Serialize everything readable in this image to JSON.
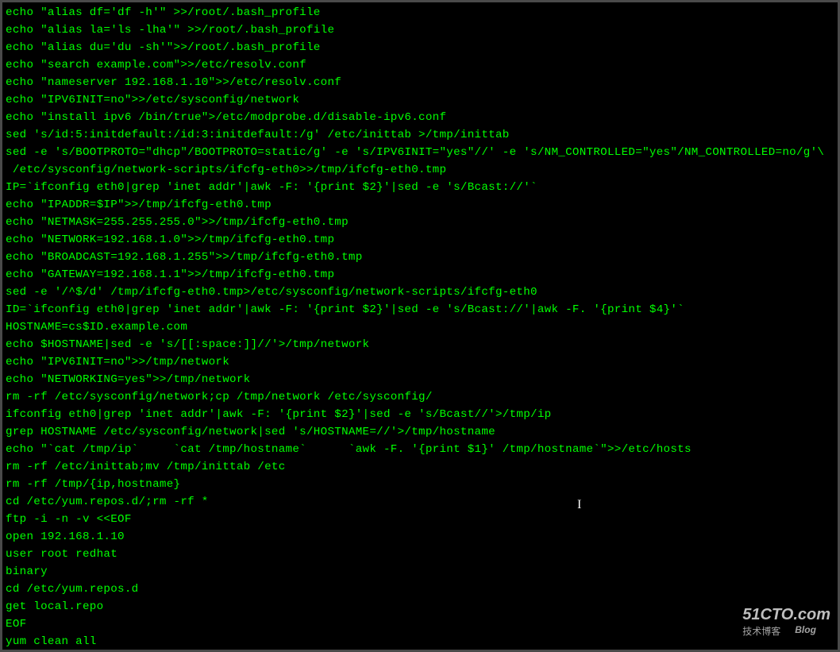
{
  "terminal": {
    "lines": [
      "echo \"alias df='df -h'\" >>/root/.bash_profile",
      "echo \"alias la='ls -lha'\" >>/root/.bash_profile",
      "echo \"alias du='du -sh'\">>/root/.bash_profile",
      "echo \"search example.com\">>/etc/resolv.conf",
      "echo \"nameserver 192.168.1.10\">>/etc/resolv.conf",
      "echo \"IPV6INIT=no\">>/etc/sysconfig/network",
      "echo \"install ipv6 /bin/true\">/etc/modprobe.d/disable-ipv6.conf",
      "sed 's/id:5:initdefault:/id:3:initdefault:/g' /etc/inittab >/tmp/inittab",
      "sed -e 's/BOOTPROTO=\"dhcp\"/BOOTPROTO=static/g' -e 's/IPV6INIT=\"yes\"//' -e 's/NM_CONTROLLED=\"yes\"/NM_CONTROLLED=no/g'\\",
      " /etc/sysconfig/network-scripts/ifcfg-eth0>>/tmp/ifcfg-eth0.tmp",
      "IP=`ifconfig eth0|grep 'inet addr'|awk -F: '{print $2}'|sed -e 's/Bcast://'`",
      "echo \"IPADDR=$IP\">>/tmp/ifcfg-eth0.tmp",
      "echo \"NETMASK=255.255.255.0\">>/tmp/ifcfg-eth0.tmp",
      "echo \"NETWORK=192.168.1.0\">>/tmp/ifcfg-eth0.tmp",
      "echo \"BROADCAST=192.168.1.255\">>/tmp/ifcfg-eth0.tmp",
      "echo \"GATEWAY=192.168.1.1\">>/tmp/ifcfg-eth0.tmp",
      "sed -e '/^$/d' /tmp/ifcfg-eth0.tmp>/etc/sysconfig/network-scripts/ifcfg-eth0",
      "ID=`ifconfig eth0|grep 'inet addr'|awk -F: '{print $2}'|sed -e 's/Bcast://'|awk -F. '{print $4}'`",
      "HOSTNAME=cs$ID.example.com",
      "echo $HOSTNAME|sed -e 's/[[:space:]]//'>/tmp/network",
      "echo \"IPV6INIT=no\">>/tmp/network",
      "echo \"NETWORKING=yes\">>/tmp/network",
      "rm -rf /etc/sysconfig/network;cp /tmp/network /etc/sysconfig/",
      "ifconfig eth0|grep 'inet addr'|awk -F: '{print $2}'|sed -e 's/Bcast//'>/tmp/ip",
      "grep HOSTNAME /etc/sysconfig/network|sed 's/HOSTNAME=//'>/tmp/hostname",
      "echo \"`cat /tmp/ip`     `cat /tmp/hostname`      `awk -F. '{print $1}' /tmp/hostname`\">>/etc/hosts",
      "rm -rf /etc/inittab;mv /tmp/inittab /etc",
      "rm -rf /tmp/{ip,hostname}",
      "cd /etc/yum.repos.d/;rm -rf *",
      "ftp -i -n -v <<EOF",
      "open 192.168.1.10",
      "user root redhat",
      "binary",
      "cd /etc/yum.repos.d",
      "get local.repo",
      "EOF",
      "yum clean all"
    ]
  },
  "watermark": {
    "main": "51CTO.com",
    "sub1": "技术博客",
    "sub2": "Blog"
  },
  "cursor_glyph": "I"
}
